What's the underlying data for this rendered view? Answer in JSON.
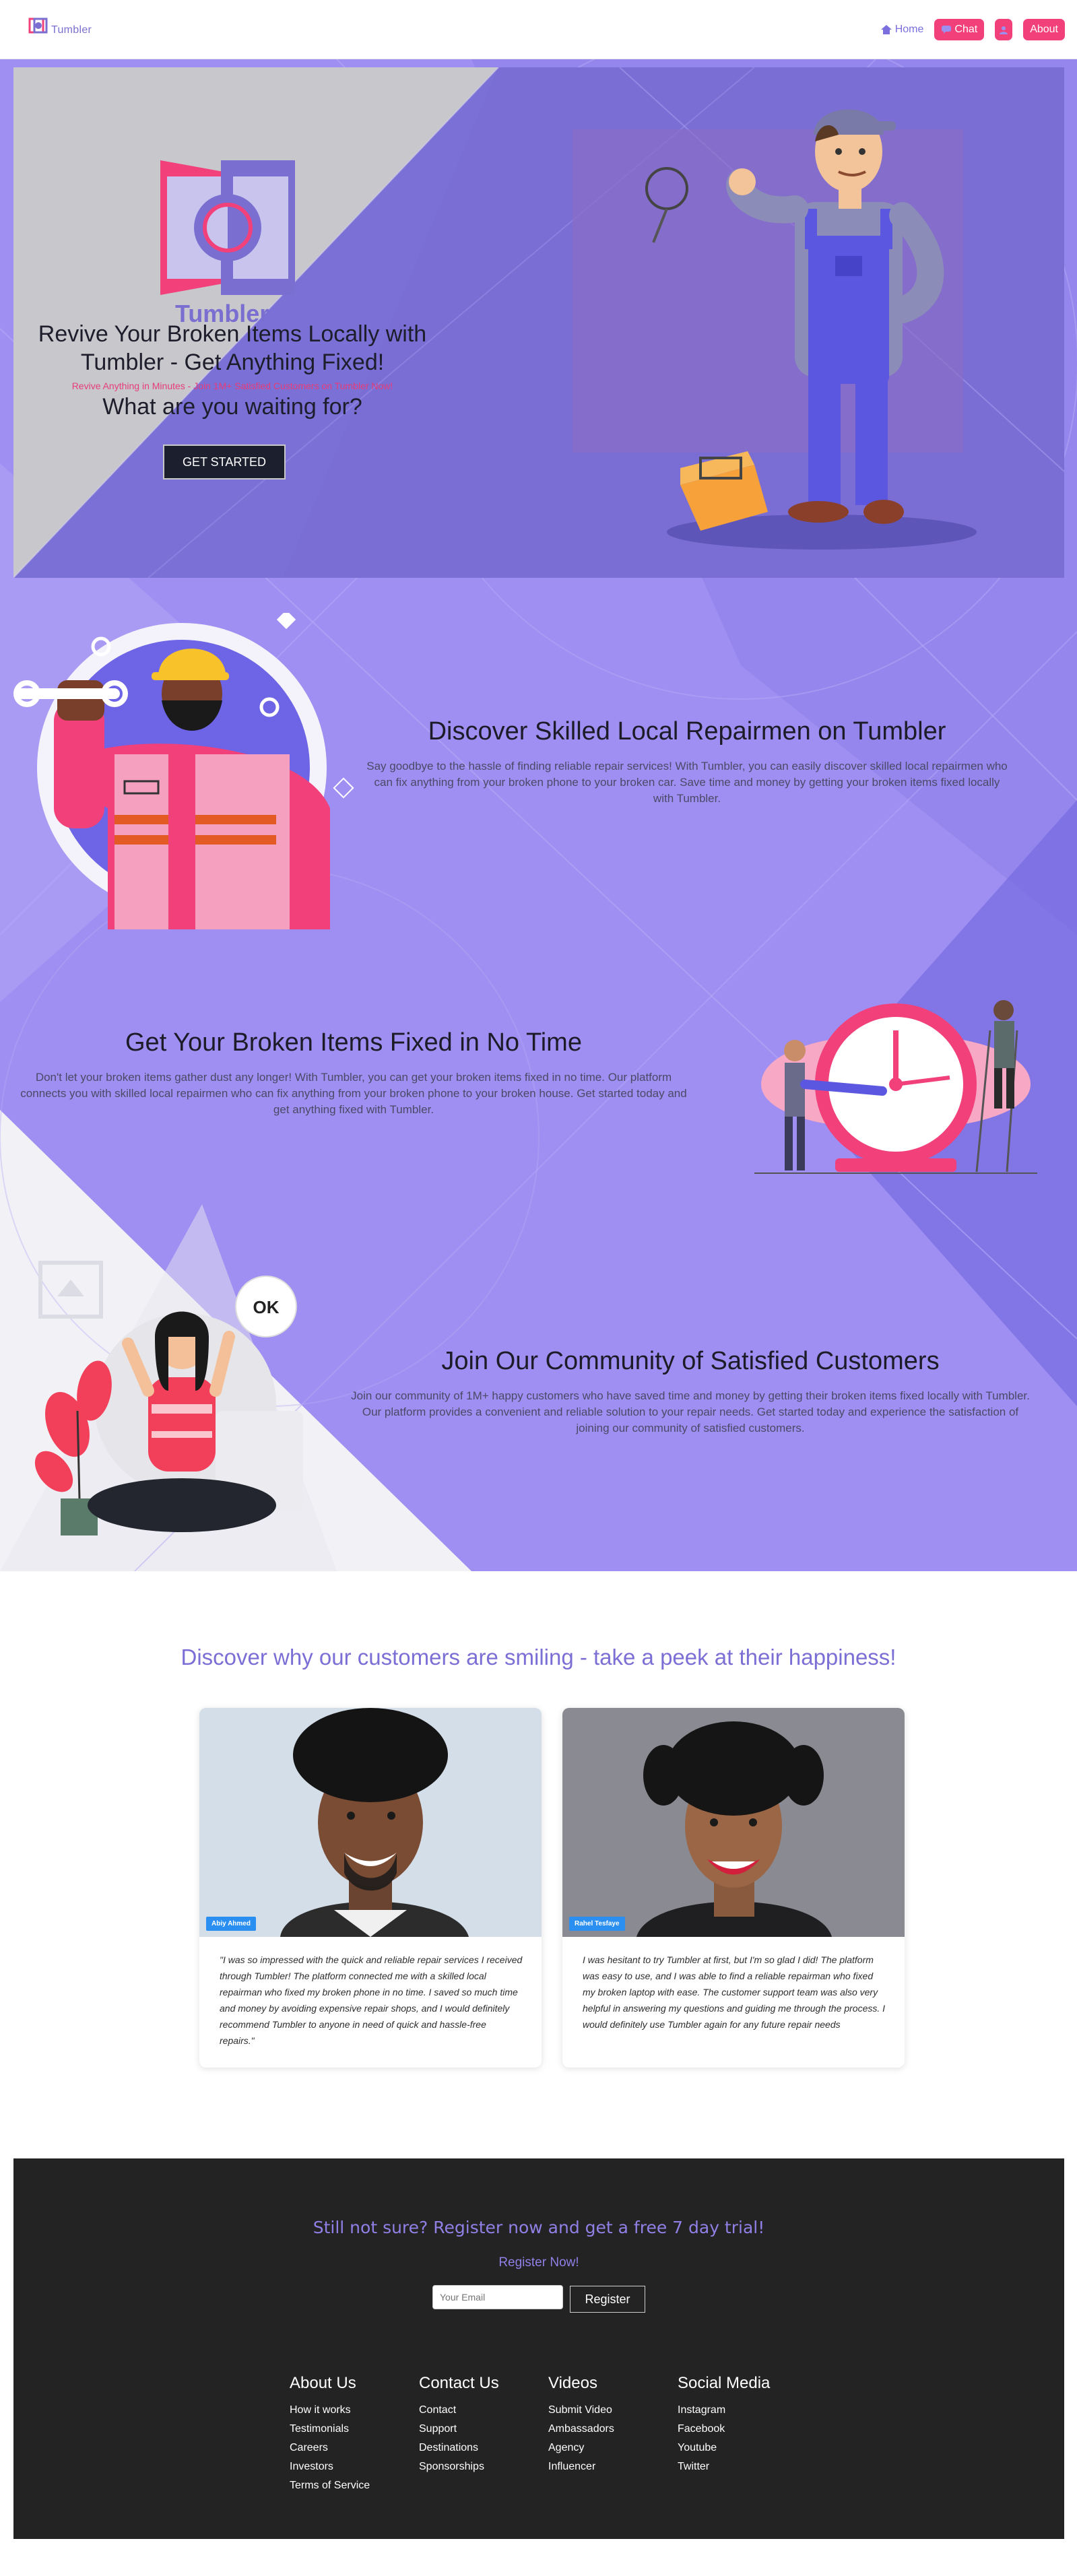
{
  "nav": {
    "brand": "Tumbler",
    "home": "Home",
    "chat": "Chat",
    "about": "About"
  },
  "hero": {
    "logo_text": "Tumbler",
    "title_line1": "Revive Your Broken Items Locally with",
    "title_line2": "Tumbler - Get Anything Fixed!",
    "subtitle": "Revive Anything in Minutes - Join 1M+ Satisfied Customers on Tumbler Now!",
    "question": "What are you waiting for?",
    "cta": "GET STARTED"
  },
  "features": [
    {
      "title": "Discover Skilled Local Repairmen on Tumbler",
      "text": "Say goodbye to the hassle of finding reliable repair services! With Tumbler, you can easily discover skilled local repairmen who can fix anything from your broken phone to your broken car. Save time and money by getting your broken items fixed locally with Tumbler."
    },
    {
      "title": "Get Your Broken Items Fixed in No Time",
      "text": "Don't let your broken items gather dust any longer! With Tumbler, you can get your broken items fixed in no time. Our platform connects you with skilled local repairmen who can fix anything from your broken phone to your broken house. Get started today and get anything fixed with Tumbler."
    },
    {
      "title": "Join Our Community of Satisfied Customers",
      "text": "Join our community of 1M+ happy customers who have saved time and money by getting their broken items fixed locally with Tumbler. Our platform provides a convenient and reliable solution to your repair needs. Get started today and experience the satisfaction of joining our community of satisfied customers."
    }
  ],
  "ok_bubble": "OK",
  "testimonials": {
    "title": "Discover why our customers are smiling - take a peek at their happiness!",
    "items": [
      {
        "name": "Abiy Ahmed",
        "quote": "\"I was so impressed with the quick and reliable repair services I received through Tumbler! The platform connected me with a skilled local repairman who fixed my broken phone in no time. I saved so much time and money by avoiding expensive repair shops, and I would definitely recommend Tumbler to anyone in need of quick and hassle-free repairs.\""
      },
      {
        "name": "Rahel Tesfaye",
        "quote": "I was hesitant to try Tumbler at first, but I'm so glad I did! The platform was easy to use, and I was able to find a reliable repairman who fixed my broken laptop with ease. The customer support team was also very helpful in answering my questions and guiding me through the process. I would definitely use Tumbler again for any future repair needs"
      }
    ]
  },
  "footer": {
    "cta": "Still not sure? Register now and get a free 7 day trial!",
    "register_link": "Register Now!",
    "email_placeholder": "Your Email",
    "register_button": "Register",
    "columns": [
      {
        "title": "About Us",
        "links": [
          "How it works",
          "Testimonials",
          "Careers",
          "Investors",
          "Terms of Service"
        ]
      },
      {
        "title": "Contact Us",
        "links": [
          "Contact",
          "Support",
          "Destinations",
          "Sponsorships"
        ]
      },
      {
        "title": "Videos",
        "links": [
          "Submit Video",
          "Ambassadors",
          "Agency",
          "Influencer"
        ]
      },
      {
        "title": "Social Media",
        "links": [
          "Instagram",
          "Facebook",
          "Youtube",
          "Twitter"
        ]
      }
    ]
  },
  "colors": {
    "accent": "#f2407a",
    "purple": "#7b6fd6",
    "background_purple": "#9f8ff2",
    "footer_bg": "#232323"
  }
}
